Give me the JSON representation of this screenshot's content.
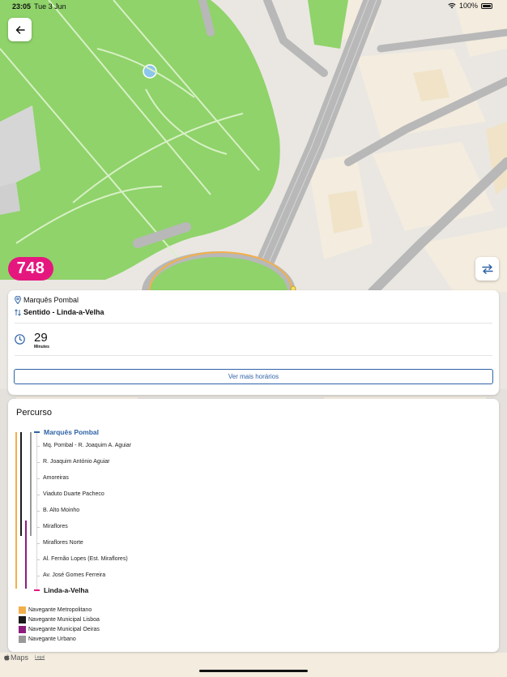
{
  "status_bar": {
    "time": "23:05",
    "date": "Tue 3 Jun",
    "battery": "100%"
  },
  "route": {
    "number": "748",
    "color": "#e5177f"
  },
  "info_card": {
    "stop_name": "Marquês Pombal",
    "direction_label": "Sentido - Linda-a-Velha",
    "minutes_value": "29",
    "minutes_label": "Minutes",
    "more_times_label": "Ver mais horários"
  },
  "route_card": {
    "title": "Percurso",
    "origin": "Marquês Pombal",
    "destination": "Linda-a-Velha",
    "stops": [
      "Mq. Pombal - R. Joaquim A. Aguiar",
      "R. Joaquim António Aguiar",
      "Amoreiras",
      "Viaduto Duarte Pacheco",
      "B. Alto Moinho",
      "Miraflores",
      "Miraflores Norte",
      "Al. Fernão Lopes (Est. Miraflores)",
      "Av. José Gomes Ferreira"
    ],
    "legend": [
      {
        "label": "Navegante Metropolitano",
        "color": "#f2b04a"
      },
      {
        "label": "Navegante Municipal Lisboa",
        "color": "#1a1a1a"
      },
      {
        "label": "Navegante Municipal Oeiras",
        "color": "#8e1d7d"
      },
      {
        "label": "Navegante Urbano",
        "color": "#999999"
      }
    ]
  },
  "map": {
    "attribution": "Maps",
    "legal": "Legal"
  },
  "colors": {
    "accent": "#2f63a6",
    "park": "#8fd36a",
    "road": "#b8b8b8"
  },
  "icons": [
    "back-arrow-icon",
    "swap-direction-icon",
    "location-pin-icon",
    "direction-arrows-icon",
    "clock-icon",
    "apple-logo-icon",
    "wifi-icon",
    "battery-icon"
  ]
}
